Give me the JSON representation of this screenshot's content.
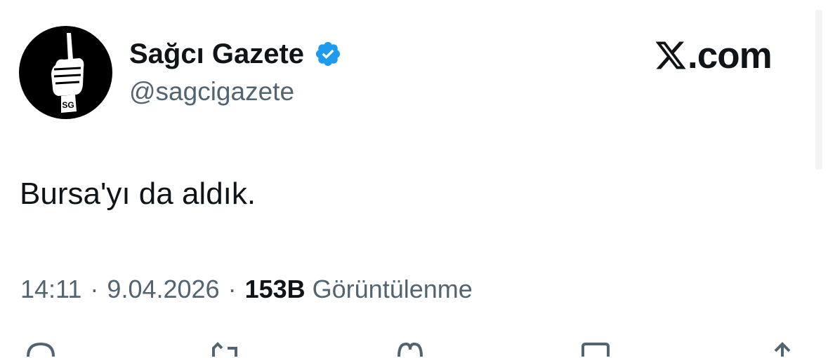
{
  "tweet": {
    "author": {
      "display_name": "Sağcı Gazete",
      "handle": "@sagcigazete",
      "verified": true,
      "avatar_icon": "raised-fist-avatar-icon",
      "avatar_text": "SG"
    },
    "brand": {
      "icon": "x-logo-icon",
      "text": ".com"
    },
    "text": "Bursa'yı da aldık.",
    "meta": {
      "time": "14:11",
      "separator": "·",
      "date": "9.04.2026",
      "views_count": "153B",
      "views_label": "Görüntülenme"
    },
    "actions": [
      "reply-icon",
      "retweet-icon",
      "like-icon",
      "bookmark-icon",
      "share-icon"
    ]
  },
  "colors": {
    "text": "#0f1419",
    "secondary": "#536471",
    "verified": "#1d9bf0"
  }
}
